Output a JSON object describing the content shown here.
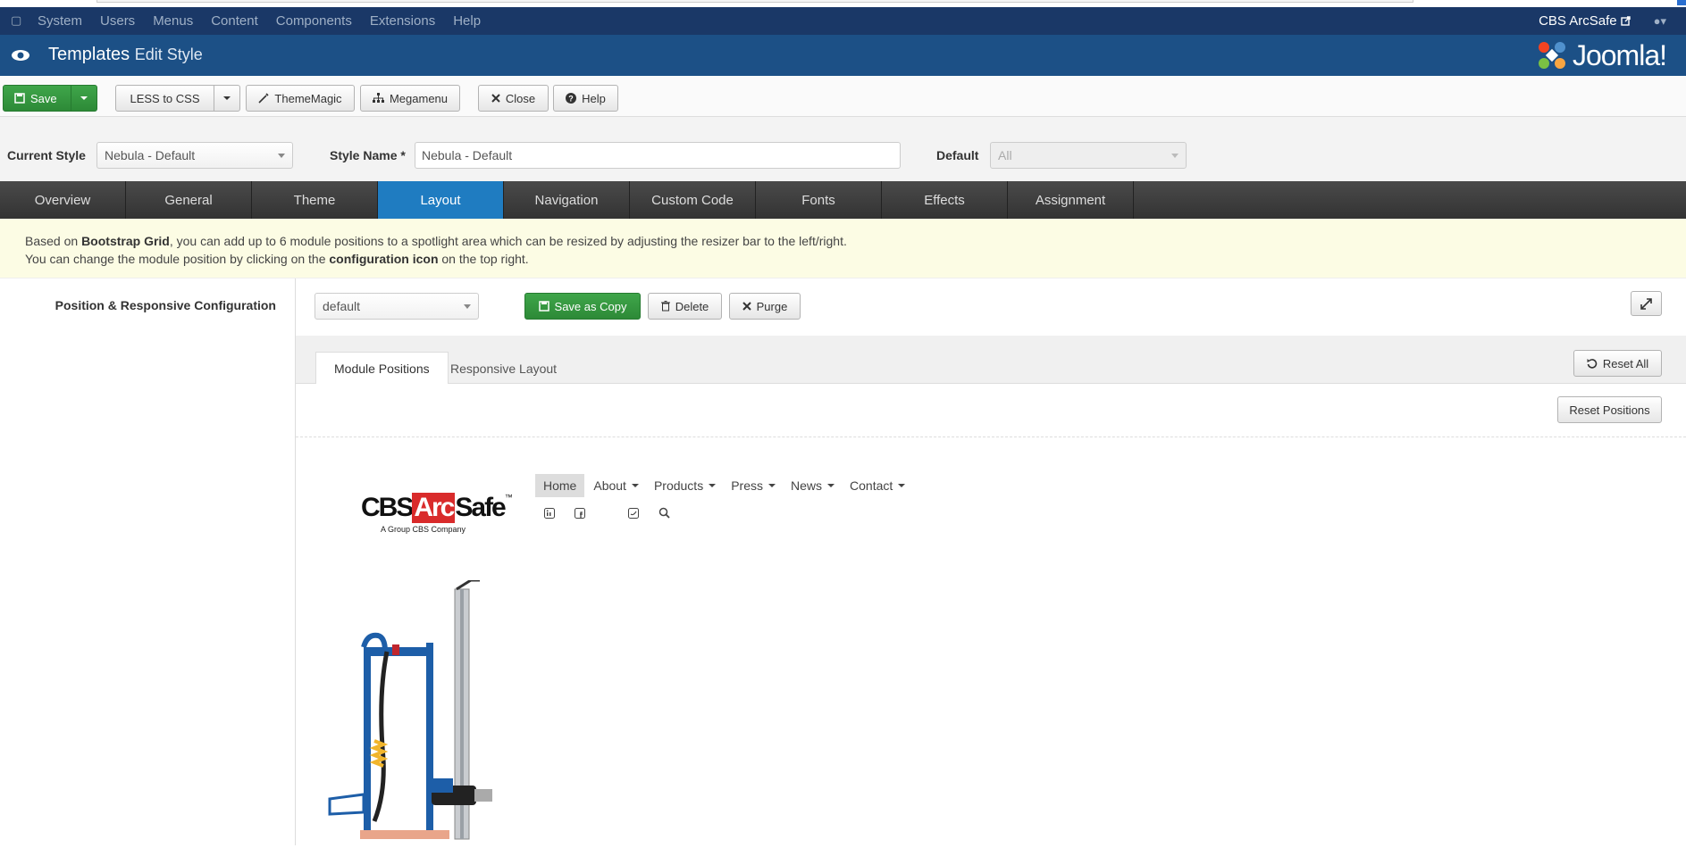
{
  "admin_menu": {
    "items": [
      "System",
      "Users",
      "Menus",
      "Content",
      "Components",
      "Extensions",
      "Help"
    ],
    "site_name": "CBS ArcSafe"
  },
  "header": {
    "title": "Templates",
    "subtitle": "Edit Style",
    "logo_text": "Joomla!"
  },
  "toolbar": {
    "save": "Save",
    "less_to_css": "LESS to CSS",
    "thememagic": "ThemeMagic",
    "megamenu": "Megamenu",
    "close": "Close",
    "help": "Help"
  },
  "style_row": {
    "current_style_label": "Current Style",
    "current_style_value": "Nebula - Default",
    "style_name_label": "Style Name *",
    "style_name_value": "Nebula - Default",
    "default_label": "Default",
    "default_value": "All"
  },
  "tabs": [
    "Overview",
    "General",
    "Theme",
    "Layout",
    "Navigation",
    "Custom Code",
    "Fonts",
    "Effects",
    "Assignment"
  ],
  "active_tab": "Layout",
  "info": {
    "line1_pre": "Based on ",
    "line1_bold": "Bootstrap Grid",
    "line1_post": ", you can add up to 6 module positions to a spotlight area which can be resized by adjusting the resizer bar to the left/right.",
    "line2_pre": "You can change the module position by clicking on the ",
    "line2_bold": "configuration icon",
    "line2_post": " on the top right."
  },
  "layout_panel": {
    "config_label": "Position & Responsive Configuration",
    "layout_select": "default",
    "save_as_copy": "Save as Copy",
    "delete": "Delete",
    "purge": "Purge",
    "subtabs": [
      "Module Positions",
      "Responsive Layout"
    ],
    "reset_all": "Reset All",
    "reset_positions": "Reset Positions"
  },
  "preview": {
    "nav": [
      "Home",
      "About",
      "Products",
      "Press",
      "News",
      "Contact"
    ],
    "brand_cbs": "CBS",
    "brand_arc": "Arc",
    "brand_safe": "Safe",
    "brand_tm": "™",
    "brand_tagline": "A Group CBS Company"
  },
  "colors": {
    "admin_bar": "#1a3867",
    "header": "#1c5086",
    "active_tab": "#1f7cc1",
    "save_green": "#2d8a37",
    "info_bg": "#fcfce4"
  }
}
